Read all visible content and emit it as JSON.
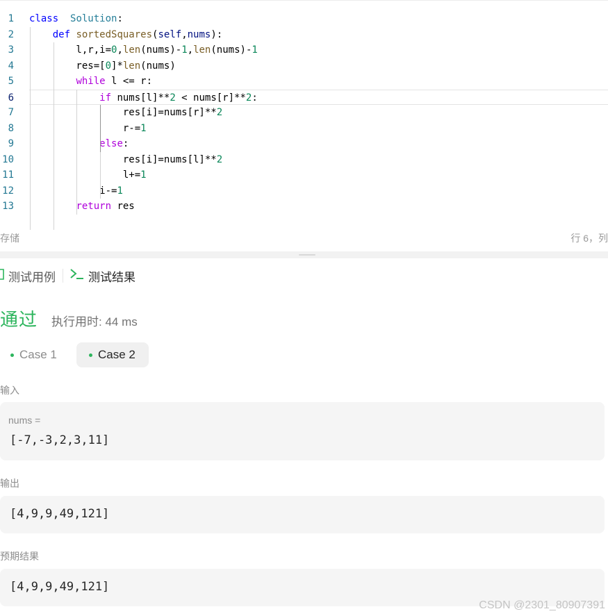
{
  "editor": {
    "lines": [
      {
        "n": "1",
        "tokens": [
          [
            "kw",
            "class"
          ],
          [
            "",
            "  "
          ],
          [
            "cls",
            "Solution"
          ],
          [
            "",
            ":"
          ]
        ]
      },
      {
        "n": "2",
        "tokens": [
          [
            "",
            "    "
          ],
          [
            "kw",
            "def"
          ],
          [
            "",
            " "
          ],
          [
            "fn",
            "sortedSquares"
          ],
          [
            "",
            "("
          ],
          [
            "slf",
            "self"
          ],
          [
            "",
            ","
          ],
          [
            "slf",
            "nums"
          ],
          [
            "",
            "):"
          ]
        ]
      },
      {
        "n": "3",
        "tokens": [
          [
            "",
            "        l,r,i="
          ],
          [
            "num",
            "0"
          ],
          [
            "",
            ","
          ],
          [
            "fn",
            "len"
          ],
          [
            "",
            "(nums)-"
          ],
          [
            "num",
            "1"
          ],
          [
            "",
            ","
          ],
          [
            "fn",
            "len"
          ],
          [
            "",
            "(nums)-"
          ],
          [
            "num",
            "1"
          ]
        ]
      },
      {
        "n": "4",
        "tokens": [
          [
            "",
            "        res=["
          ],
          [
            "num",
            "0"
          ],
          [
            "",
            "]*"
          ],
          [
            "fn",
            "len"
          ],
          [
            "",
            "(nums)"
          ]
        ]
      },
      {
        "n": "5",
        "tokens": [
          [
            "",
            "        "
          ],
          [
            "kw2",
            "while"
          ],
          [
            "",
            " l <= r:"
          ]
        ]
      },
      {
        "n": "6",
        "tokens": [
          [
            "",
            "            "
          ],
          [
            "kw2",
            "if"
          ],
          [
            "",
            " nums[l]**"
          ],
          [
            "num",
            "2"
          ],
          [
            "",
            " < nums[r]**"
          ],
          [
            "num",
            "2"
          ],
          [
            "",
            ":"
          ]
        ]
      },
      {
        "n": "7",
        "tokens": [
          [
            "",
            "                res[i]=nums[r]**"
          ],
          [
            "num",
            "2"
          ]
        ]
      },
      {
        "n": "8",
        "tokens": [
          [
            "",
            "                r-="
          ],
          [
            "num",
            "1"
          ]
        ]
      },
      {
        "n": "9",
        "tokens": [
          [
            "",
            "            "
          ],
          [
            "kw2",
            "else"
          ],
          [
            "",
            ":"
          ]
        ]
      },
      {
        "n": "10",
        "tokens": [
          [
            "",
            "                res[i]=nums[l]**"
          ],
          [
            "num",
            "2"
          ]
        ]
      },
      {
        "n": "11",
        "tokens": [
          [
            "",
            "                l+="
          ],
          [
            "num",
            "1"
          ]
        ]
      },
      {
        "n": "12",
        "tokens": [
          [
            "",
            "            i-="
          ],
          [
            "num",
            "1"
          ]
        ]
      },
      {
        "n": "13",
        "tokens": [
          [
            "",
            "        "
          ],
          [
            "kw2",
            "return"
          ],
          [
            "",
            " res"
          ]
        ]
      }
    ],
    "current_line": 6
  },
  "status": {
    "left": "存储",
    "right": "行 6，列"
  },
  "tabs": {
    "testcase": "测试用例",
    "result": "测试结果"
  },
  "result": {
    "verdict": "通过",
    "runtime": "执行用时: 44 ms",
    "cases": [
      "Case 1",
      "Case 2"
    ],
    "selected_case": "Case 2",
    "input_label": "输入",
    "input_var": "nums =",
    "input_value": "[-7,-3,2,3,11]",
    "output_label": "输出",
    "output_value": "[4,9,9,49,121]",
    "expected_label": "预期结果",
    "expected_value": "[4,9,9,49,121]"
  },
  "watermark": "CSDN @2301_80907391",
  "colors": {
    "pass": "#2db55d",
    "keyword": "#0000ff",
    "control": "#af00db",
    "number": "#098658",
    "class": "#267f99",
    "function": "#795e26"
  }
}
